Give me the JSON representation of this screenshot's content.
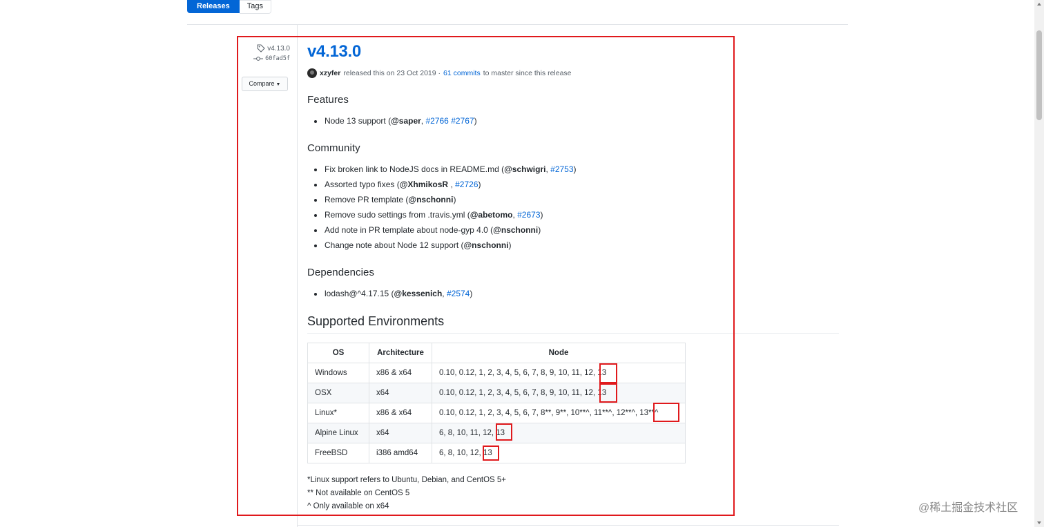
{
  "tabs": {
    "releases": "Releases",
    "tags": "Tags"
  },
  "sidebar": {
    "tag": "v4.13.0",
    "commit": "60fad5f",
    "compare_label": "Compare"
  },
  "release": {
    "title": "v4.13.0",
    "author": "xzyfer",
    "released_text": "released this on 23 Oct 2019 ·",
    "commits_link": "61 commits",
    "since_text": "to master since this release"
  },
  "sections": {
    "features": {
      "title": "Features",
      "items": [
        {
          "pre": "Node 13 support (",
          "user": "@saper",
          "sep": ", ",
          "links": [
            "#2766",
            "#2767"
          ],
          "post": ")"
        }
      ]
    },
    "community": {
      "title": "Community",
      "items": [
        {
          "pre": "Fix broken link to NodeJS docs in README.md (",
          "user": "@schwigri",
          "sep": ", ",
          "links": [
            "#2753"
          ],
          "post": ")"
        },
        {
          "pre": "Assorted typo fixes (",
          "user": "@XhmikosR",
          "sep": " , ",
          "links": [
            "#2726"
          ],
          "post": ")"
        },
        {
          "pre": "Remove PR template (",
          "user": "@nschonni",
          "sep": "",
          "links": [],
          "post": ")"
        },
        {
          "pre": "Remove sudo settings from .travis.yml (",
          "user": "@abetomo",
          "sep": ", ",
          "links": [
            "#2673"
          ],
          "post": ")"
        },
        {
          "pre": "Add note in PR template about node-gyp 4.0 (",
          "user": "@nschonni",
          "sep": "",
          "links": [],
          "post": ")"
        },
        {
          "pre": "Change note about Node 12 support (",
          "user": "@nschonni",
          "sep": "",
          "links": [],
          "post": ")"
        }
      ]
    },
    "dependencies": {
      "title": "Dependencies",
      "items": [
        {
          "pre": "lodash@^4.17.15 (",
          "user": "@kessenich",
          "sep": ", ",
          "links": [
            "#2574"
          ],
          "post": ")"
        }
      ]
    }
  },
  "environments": {
    "title": "Supported Environments",
    "headers": [
      "OS",
      "Architecture",
      "Node"
    ],
    "rows": [
      [
        "Windows",
        "x86 & x64",
        "0.10, 0.12, 1, 2, 3, 4, 5, 6, 7, 8, 9, 10, 11, 12, 13"
      ],
      [
        "OSX",
        "x64",
        "0.10, 0.12, 1, 2, 3, 4, 5, 6, 7, 8, 9, 10, 11, 12, 13"
      ],
      [
        "Linux*",
        "x86 & x64",
        "0.10, 0.12, 1, 2, 3, 4, 5, 6, 7, 8**, 9**, 10**^, 11**^, 12**^, 13**^"
      ],
      [
        "Alpine Linux",
        "x64",
        "6, 8, 10, 11, 12, 13"
      ],
      [
        "FreeBSD",
        "i386 amd64",
        "6, 8, 10, 12, 13"
      ]
    ],
    "notes": [
      "*Linux support refers to Ubuntu, Debian, and CentOS 5+",
      "** Not available on CentOS 5",
      "^ Only available on x64"
    ]
  },
  "watermark": "@稀土掘金技术社区",
  "colors": {
    "accent": "#0366d6",
    "highlight": "#e0191c"
  },
  "icons": {
    "tag": "tag-icon",
    "commit": "commit-icon",
    "caret": "caret-down-icon"
  }
}
